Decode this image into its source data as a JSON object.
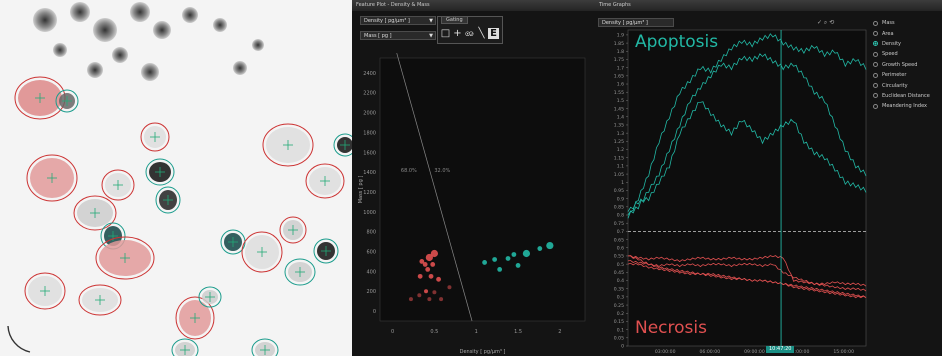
{
  "feature_panel": {
    "title": "Feature Plot - Density & Mass",
    "y_selector": "Density [ pg/µm³ ]",
    "x_selector": "Mass [ pg ]",
    "gating_label": "Gating",
    "gating_tools": [
      "rectangle-tool",
      "crosshair-tool",
      "lasso-tool",
      "line-tool",
      "ellipse-tool"
    ],
    "y_axis_label": "Mass [ pg ]",
    "x_axis_label": "Density [ pg/µm³ ]",
    "y_ticks": [
      "2400",
      "2200",
      "2000",
      "1800",
      "1600",
      "1400",
      "1200",
      "1000",
      "800",
      "600",
      "400",
      "200",
      "0"
    ],
    "x_ticks": [
      "0",
      "0.5",
      "1",
      "1.5",
      "2"
    ],
    "gate_pct_left": "68.0%",
    "gate_pct_right": "32.0%"
  },
  "time_panel": {
    "title": "Time Graphs",
    "selector": "Density [ pg/µm³ ]",
    "toolbar_icons": "✓ ⌕ ⟲",
    "top_label": "Apoptosis",
    "bottom_label": "Necrosis",
    "y_ticks_top": [
      "1.9",
      "1.85",
      "1.8",
      "1.75",
      "1.7",
      "1.65",
      "1.6",
      "1.55",
      "1.5",
      "1.45",
      "1.4",
      "1.35",
      "1.3",
      "1.25",
      "1.2",
      "1.15",
      "1.1",
      "1.05",
      "1",
      "0.95",
      "0.9",
      "0.85",
      "0.8",
      "0.75"
    ],
    "y_ticks_bottom": [
      "0.7",
      "0.65",
      "0.6",
      "0.55",
      "0.5",
      "0.45",
      "0.4",
      "0.35",
      "0.3",
      "0.25",
      "0.2",
      "0.15",
      "0.1",
      "0.05",
      "0"
    ],
    "x_ticks": [
      "03:00:00",
      "06:00:00",
      "09:00:00",
      "12:00:00",
      "15:00:00"
    ],
    "cursor_time": "10:47:20",
    "legend": [
      {
        "label": "Mass",
        "selected": false
      },
      {
        "label": "Area",
        "selected": false
      },
      {
        "label": "Density",
        "selected": true
      },
      {
        "label": "Speed",
        "selected": false
      },
      {
        "label": "Growth Speed",
        "selected": false
      },
      {
        "label": "Perimeter",
        "selected": false
      },
      {
        "label": "Circularity",
        "selected": false
      },
      {
        "label": "Euclidean Distance",
        "selected": false
      },
      {
        "label": "Meandering Index",
        "selected": false
      }
    ]
  },
  "colors": {
    "teal": "#22b8a5",
    "red": "#e05050",
    "panel": "#141414"
  },
  "chart_data": [
    {
      "type": "scatter",
      "xlabel": "Density [ pg/µm³ ]",
      "ylabel": "Mass [ pg ]",
      "xlim": [
        -0.15,
        2.3
      ],
      "ylim": [
        -100,
        2550
      ],
      "gate_line": [
        [
          0.05,
          2600
        ],
        [
          0.95,
          -100
        ]
      ],
      "series": [
        {
          "name": "red",
          "points": [
            [
              0.5,
              580
            ],
            [
              0.44,
              540
            ],
            [
              0.35,
              500
            ],
            [
              0.39,
              470
            ],
            [
              0.48,
              470
            ],
            [
              0.42,
              420
            ],
            [
              0.46,
              350
            ],
            [
              0.55,
              320
            ],
            [
              0.33,
              350
            ],
            [
              0.4,
              200
            ],
            [
              0.5,
              190
            ],
            [
              0.32,
              160
            ],
            [
              0.44,
              120
            ],
            [
              0.58,
              120
            ],
            [
              0.22,
              120
            ],
            [
              0.68,
              240
            ]
          ]
        },
        {
          "name": "teal",
          "points": [
            [
              1.88,
              660
            ],
            [
              1.6,
              580
            ],
            [
              1.76,
              630
            ],
            [
              1.5,
              460
            ],
            [
              1.28,
              420
            ],
            [
              1.22,
              520
            ],
            [
              1.38,
              530
            ],
            [
              1.45,
              570
            ],
            [
              1.1,
              490
            ]
          ]
        }
      ]
    },
    {
      "type": "line",
      "xlabel": "",
      "ylabel": "Density [ pg/µm³ ]",
      "x_hours": [
        0.5,
        16.5
      ],
      "ylim": [
        0,
        1.93
      ],
      "threshold": 0.7,
      "cursor_hour": 10.79,
      "series": [
        {
          "name": "a1",
          "values": [
            0.78,
            0.9,
            1.05,
            1.25,
            1.4,
            1.55,
            1.62,
            1.7,
            1.68,
            1.75,
            1.82,
            1.86,
            1.84,
            1.88,
            1.9,
            1.85,
            1.82,
            1.8,
            1.83,
            1.78,
            1.8,
            1.72,
            1.75,
            1.7
          ]
        },
        {
          "name": "a2",
          "values": [
            0.8,
            0.85,
            0.95,
            1.05,
            1.2,
            1.35,
            1.5,
            1.58,
            1.65,
            1.72,
            1.7,
            1.76,
            1.75,
            1.78,
            1.74,
            1.7,
            1.72,
            1.65,
            1.55,
            1.5,
            1.35,
            1.2,
            1.1,
            1.05
          ]
        },
        {
          "name": "a3",
          "values": [
            0.82,
            0.88,
            0.9,
            1.0,
            1.1,
            1.3,
            1.4,
            1.5,
            1.42,
            1.35,
            1.3,
            1.38,
            1.32,
            1.25,
            1.3,
            1.35,
            1.38,
            1.25,
            1.18,
            1.15,
            1.08,
            1.0,
            0.98,
            0.95
          ]
        },
        {
          "name": "n1",
          "values": [
            0.55,
            0.54,
            0.53,
            0.54,
            0.53,
            0.52,
            0.53,
            0.54,
            0.53,
            0.53,
            0.54,
            0.53,
            0.53,
            0.54,
            0.55,
            0.54,
            0.4,
            0.39,
            0.38,
            0.38,
            0.39,
            0.38,
            0.38,
            0.37
          ]
        },
        {
          "name": "n2",
          "values": [
            0.52,
            0.51,
            0.5,
            0.49,
            0.5,
            0.49,
            0.5,
            0.49,
            0.5,
            0.5,
            0.49,
            0.5,
            0.5,
            0.49,
            0.5,
            0.45,
            0.42,
            0.4,
            0.38,
            0.37,
            0.36,
            0.35,
            0.35,
            0.34
          ]
        },
        {
          "name": "n3",
          "values": [
            0.5,
            0.5,
            0.48,
            0.47,
            0.46,
            0.45,
            0.44,
            0.44,
            0.43,
            0.42,
            0.41,
            0.41,
            0.4,
            0.4,
            0.39,
            0.38,
            0.36,
            0.35,
            0.34,
            0.33,
            0.32,
            0.31,
            0.3,
            0.3
          ]
        },
        {
          "name": "n4",
          "values": [
            0.55,
            0.53,
            0.5,
            0.48,
            0.47,
            0.46,
            0.45,
            0.44,
            0.44,
            0.43,
            0.42,
            0.41,
            0.4,
            0.4,
            0.39,
            0.38,
            0.37,
            0.36,
            0.35,
            0.34,
            0.33,
            0.32,
            0.31,
            0.3
          ]
        }
      ]
    }
  ]
}
